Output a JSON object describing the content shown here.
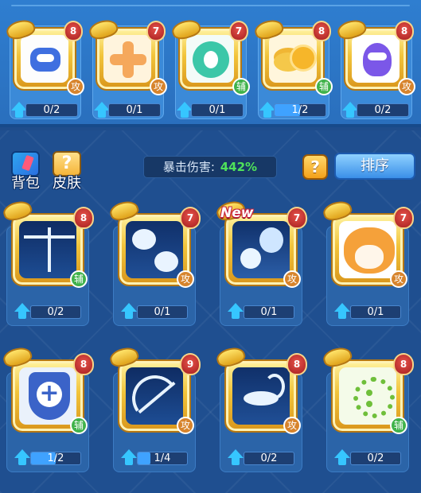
{
  "equipped": [
    {
      "name": "robot",
      "art": "art-robot",
      "level": "8",
      "role": "攻",
      "role_type": "atk",
      "progress_label": "0/2",
      "progress": 0.0
    },
    {
      "name": "cross",
      "art": "art-cross",
      "level": "7",
      "role": "攻",
      "role_type": "atk",
      "progress_label": "0/1",
      "progress": 0.0
    },
    {
      "name": "teal",
      "art": "art-teal",
      "level": "7",
      "role": "辅",
      "role_type": "sup",
      "progress_label": "0/1",
      "progress": 0.0
    },
    {
      "name": "coins",
      "art": "art-coins",
      "level": "8",
      "role": "辅",
      "role_type": "sup",
      "progress_label": "1/2",
      "progress": 0.5
    },
    {
      "name": "genie",
      "art": "art-genie",
      "level": "8",
      "role": "攻",
      "role_type": "atk",
      "progress_label": "0/2",
      "progress": 0.0
    }
  ],
  "toolbar": {
    "bag_label": "背包",
    "skin_label": "皮肤",
    "skin_icon_glyph": "?",
    "crit_label": "暴击伤害:",
    "crit_value": "442%",
    "help_glyph": "?",
    "sort_label": "排序"
  },
  "inventory": [
    {
      "name": "libra",
      "art": "art-libra",
      "level": "8",
      "role": "辅",
      "role_type": "sup",
      "progress_label": "0/2",
      "progress": 0.0,
      "is_new": false
    },
    {
      "name": "pisces",
      "art": "art-pisces",
      "level": "7",
      "role": "攻",
      "role_type": "atk",
      "progress_label": "0/1",
      "progress": 0.0,
      "is_new": false
    },
    {
      "name": "aquarius",
      "art": "art-aquarius",
      "level": "7",
      "role": "攻",
      "role_type": "atk",
      "progress_label": "0/1",
      "progress": 0.0,
      "is_new": true
    },
    {
      "name": "tiger",
      "art": "art-tiger",
      "level": "7",
      "role": "攻",
      "role_type": "atk",
      "progress_label": "0/1",
      "progress": 0.0,
      "is_new": false
    },
    {
      "name": "shield",
      "art": "art-shield",
      "level": "8",
      "role": "辅",
      "role_type": "sup",
      "progress_label": "1/2",
      "progress": 0.5,
      "is_new": false
    },
    {
      "name": "sagittarius",
      "art": "art-sagittarius",
      "level": "9",
      "role": "攻",
      "role_type": "atk",
      "progress_label": "1/4",
      "progress": 0.25,
      "is_new": false
    },
    {
      "name": "scorpio",
      "art": "art-scorpio",
      "level": "8",
      "role": "攻",
      "role_type": "atk",
      "progress_label": "0/2",
      "progress": 0.0,
      "is_new": false
    },
    {
      "name": "sprout",
      "art": "art-sprout",
      "level": "8",
      "role": "辅",
      "role_type": "sup",
      "progress_label": "0/2",
      "progress": 0.0,
      "is_new": false
    }
  ],
  "new_tag_label": "New",
  "colors": {
    "background": "#1f4d8c",
    "top_strip": "#2f7ed0",
    "crit_value": "#4fe25a",
    "attack_badge": "#d7842c",
    "support_badge": "#3fb24a",
    "level_badge": "#c0302a",
    "frame_gold": "#f2c43a",
    "upgrade_arrow": "#36c6ff"
  }
}
